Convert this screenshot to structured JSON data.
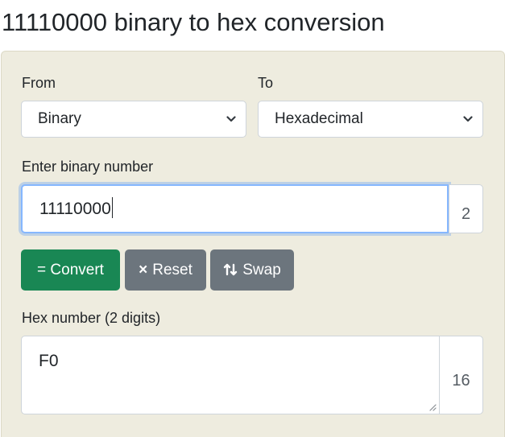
{
  "page": {
    "title": "11110000 binary to hex conversion"
  },
  "form": {
    "from_label": "From",
    "to_label": "To",
    "from_select": {
      "selected": "Binary"
    },
    "to_select": {
      "selected": "Hexadecimal"
    },
    "input_label": "Enter binary number",
    "input_value": "11110000",
    "input_base": "2",
    "buttons": {
      "convert": "= Convert",
      "reset": "Reset",
      "swap": "Swap"
    },
    "icons": {
      "reset": "close-icon",
      "swap": "swap-arrows-icon"
    },
    "output_label": "Hex number (2 digits)",
    "output_value": "F0",
    "output_base": "16"
  },
  "colors": {
    "panel_bg": "#eeecdf",
    "convert_btn": "#198754",
    "secondary_btn": "#6c757d",
    "focus_border": "#86b7fe"
  }
}
